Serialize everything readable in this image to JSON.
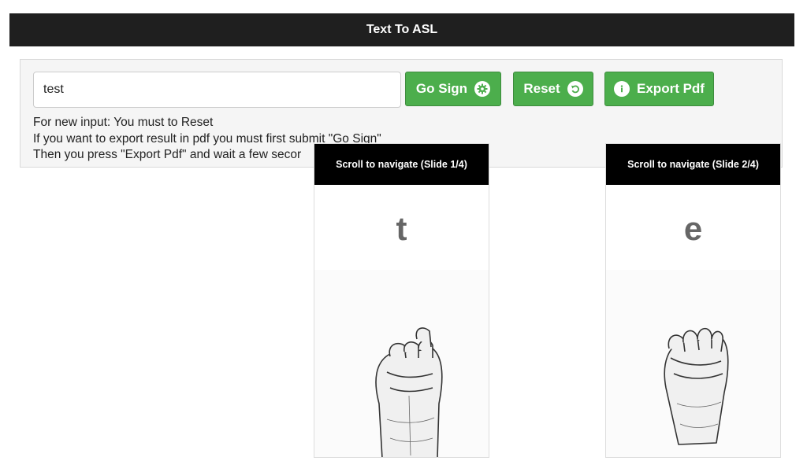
{
  "app": {
    "title": "Text To ASL"
  },
  "form": {
    "input_value": "test",
    "go_label": "Go Sign",
    "reset_label": "Reset",
    "export_label": "Export Pdf"
  },
  "help_lines": [
    "For new input: You must to Reset",
    "If you want to export result in pdf you must first submit \"Go Sign\"",
    "Then you press \"Export Pdf\" and wait a few secor"
  ],
  "slides": [
    {
      "header": "Scroll to navigate (Slide 1/4)",
      "letter": "t"
    },
    {
      "header": "Scroll to navigate (Slide 2/4)",
      "letter": "e"
    }
  ],
  "icons": {
    "go": "gear-icon",
    "reset": "undo-icon",
    "export": "info-icon"
  },
  "colors": {
    "topbar": "#1f1f1f",
    "button": "#4cae4c",
    "slide_header": "#000000"
  }
}
